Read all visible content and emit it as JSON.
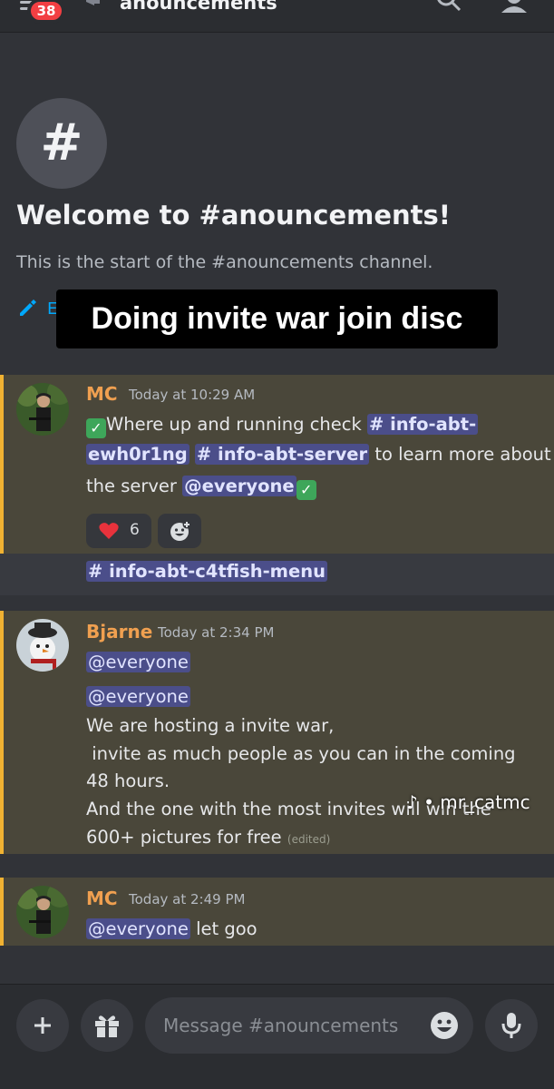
{
  "header": {
    "notification_count": "38",
    "channel_name": "anouncements"
  },
  "welcome": {
    "hash_glyph": "#",
    "title": "Welcome to #anouncements!",
    "subtitle": "This is the start of the #anouncements channel.",
    "edit_partial": "E"
  },
  "overlay_caption": "Doing invite war join disc",
  "messages": [
    {
      "author": "MC",
      "timestamp": "Today at 10:29 AM",
      "line1_text": "Where up and running check ",
      "line1_link": "# info-abt-",
      "line2_link": "ewh0r1ng",
      "line2_link2": "# info-abt-server",
      "line2_text": " to learn more about",
      "line3_text": "the server ",
      "line3_mention": "@everyone",
      "reaction_count": "6",
      "channel_link": "# info-abt-c4tfish-menu"
    },
    {
      "author": "Bjarne",
      "timestamp": "Today at 2:34 PM",
      "mention1": "@everyone",
      "mention2": "@everyone",
      "line1": "We are hosting a invite war,",
      "line2": " invite as much people as you can in the coming",
      "line3": "48 hours.",
      "line4": "And the one with the most invites will win the",
      "line5": "600+ pictures for free",
      "edited": "(edited)"
    },
    {
      "author": "MC",
      "timestamp": "Today at 2:49 PM",
      "mention": "@everyone",
      "text": " let goo"
    }
  ],
  "composer": {
    "placeholder": "Message #anouncements"
  },
  "watermark": {
    "tiktok": "♪",
    "handle": "mr_catmc"
  },
  "colors": {
    "background": "#313338",
    "highlight": "#4a473a",
    "highlight_bar": "#f0b232",
    "mention_bg": "#4b4e8a",
    "author": "#f0a050",
    "badge": "#f23f43"
  }
}
